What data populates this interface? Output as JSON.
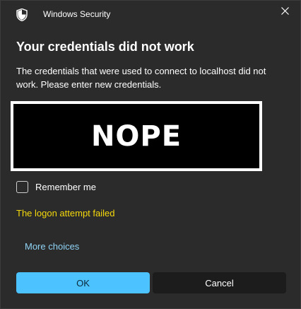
{
  "window": {
    "title": "Windows Security",
    "close_icon": "close-icon",
    "app_icon": "shield-icon"
  },
  "dialog": {
    "heading": "Your credentials did not work",
    "message": "The credentials that were used to connect to localhost did not work. Please enter new credentials.",
    "credential_tile_text": "NOPE",
    "remember_label": "Remember me",
    "remember_checked": false,
    "error_text": "The logon attempt failed",
    "more_choices_label": "More choices"
  },
  "buttons": {
    "ok_label": "OK",
    "cancel_label": "Cancel"
  },
  "colors": {
    "background": "#2b2b2b",
    "accent": "#4cc2ff",
    "error": "#f5d90c",
    "link": "#8fd3f5"
  }
}
